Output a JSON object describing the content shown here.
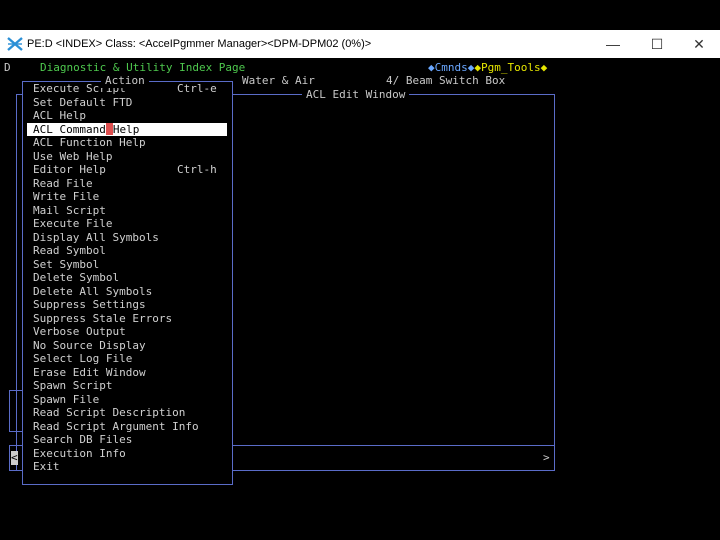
{
  "window": {
    "title": "PE:D <INDEX> Class: <AcceIPgmmer Manager><DPM-DPM02 (0%)>",
    "min_glyph": "—",
    "max_glyph": "☐",
    "close_glyph": "✕"
  },
  "header": {
    "d_marker": "D",
    "page_title": "Diagnostic & Utility Index Page",
    "cmnds": "◆Cmnds◆",
    "pgm_tools": "◆Pgm_Tools◆",
    "menu_title": "Action",
    "bg_text_water": "Water & Air",
    "bg_text_beam": "4/ Beam Switch Box",
    "edit_window_title": "ACL Edit Window"
  },
  "menu": {
    "items": [
      {
        "label": "Execute Script",
        "shortcut": "Ctrl-e"
      },
      {
        "label": "Set Default FTD",
        "shortcut": ""
      },
      {
        "label": "ACL Help",
        "shortcut": ""
      },
      {
        "label": "ACL Command Help",
        "shortcut": "",
        "selected": true
      },
      {
        "label": "ACL Function Help",
        "shortcut": ""
      },
      {
        "label": "Use Web Help",
        "shortcut": ""
      },
      {
        "label": "Editor Help",
        "shortcut": "Ctrl-h"
      },
      {
        "label": "Read File",
        "shortcut": ""
      },
      {
        "label": "Write File",
        "shortcut": ""
      },
      {
        "label": "Mail Script",
        "shortcut": ""
      },
      {
        "label": "Execute File",
        "shortcut": ""
      },
      {
        "label": "Display All Symbols",
        "shortcut": ""
      },
      {
        "label": "Read Symbol",
        "shortcut": ""
      },
      {
        "label": "Set Symbol",
        "shortcut": ""
      },
      {
        "label": "Delete Symbol",
        "shortcut": ""
      },
      {
        "label": "Delete All Symbols",
        "shortcut": ""
      },
      {
        "label": "Suppress Settings",
        "shortcut": ""
      },
      {
        "label": "Suppress Stale Errors",
        "shortcut": ""
      },
      {
        "label": "Verbose Output",
        "shortcut": ""
      },
      {
        "label": "No Source Display",
        "shortcut": ""
      },
      {
        "label": "Select Log File",
        "shortcut": ""
      },
      {
        "label": "Erase Edit Window",
        "shortcut": ""
      },
      {
        "label": "Spawn Script",
        "shortcut": ""
      },
      {
        "label": "Spawn File",
        "shortcut": ""
      },
      {
        "label": "Read Script Description",
        "shortcut": ""
      },
      {
        "label": "Read Script Argument Info",
        "shortcut": ""
      },
      {
        "label": "Search DB Files",
        "shortcut": ""
      },
      {
        "label": "Execution Info",
        "shortcut": ""
      },
      {
        "label": "Exit",
        "shortcut": ""
      }
    ]
  },
  "scrollbar": {
    "left_arrow": "<",
    "right_arrow": ">"
  },
  "colors": {
    "menu_border": "#5a6cc8",
    "title_green": "#4ec94e",
    "highlight": "#ffffff"
  }
}
